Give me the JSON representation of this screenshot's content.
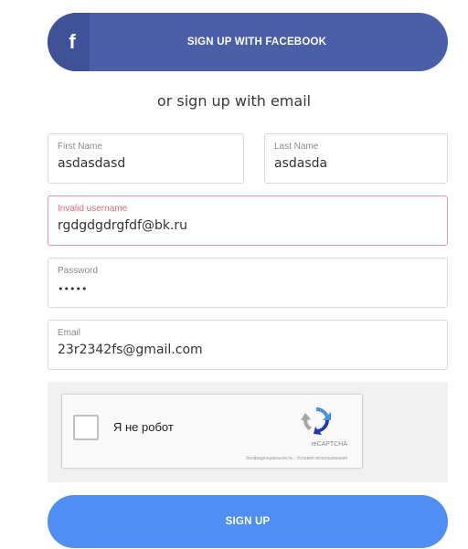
{
  "facebook": {
    "icon": "f",
    "label": "SIGN UP WITH FACEBOOK",
    "color": "#4a5fa8"
  },
  "divider": {
    "text": "or sign up with email"
  },
  "fields": {
    "first_name": {
      "label": "First Name",
      "value": "asdasdasd"
    },
    "last_name": {
      "label": "Last Name",
      "value": "asdasda"
    },
    "username": {
      "label": "Invalid username",
      "value": "rgdgdgdrgfdf@bk.ru",
      "state": "invalid"
    },
    "password": {
      "label": "Password",
      "value": "•••••"
    },
    "email": {
      "label": "Email",
      "value": "23r2342fs@gmail.com"
    }
  },
  "captcha": {
    "checkbox_label": "Я не робот",
    "brand": "reCAPTCHA",
    "terms": "Конфиденциальность - Условия использования",
    "icon": "recaptcha-logo-icon"
  },
  "signup": {
    "label": "SIGN UP",
    "color": "#4f8ef3"
  }
}
